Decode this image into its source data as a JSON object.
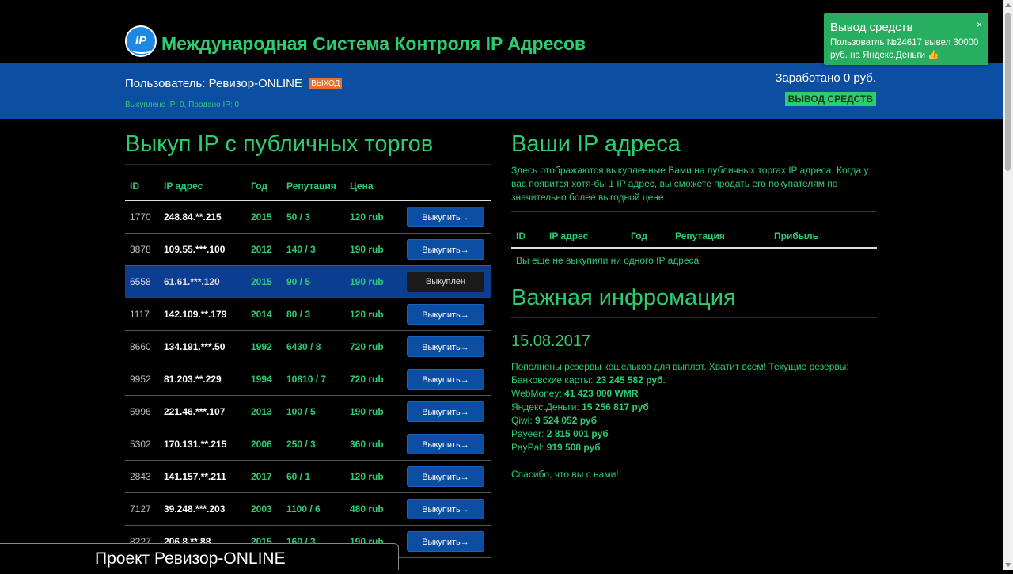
{
  "header": {
    "logo_text": "IP",
    "title": "Международная Система Контроля IP Адресов"
  },
  "userbar": {
    "user_label": "Пользователь: Ревизор-ONLINE",
    "logout": "ВЫХОД",
    "ip_stats": "Выкуплено IP: 0, Продано IP: 0",
    "earned": "Заработано 0 руб.",
    "withdraw": "ВЫВОД СРЕДСТВ"
  },
  "market": {
    "title": "Выкуп IP с публичных торгов",
    "columns": [
      "ID",
      "IP адрес",
      "Год",
      "Репутация",
      "Цена"
    ],
    "buy_label": "Выкупить",
    "bought_label": "Выкуплен",
    "rows": [
      {
        "id": "1770",
        "ip": "248.84.**.215",
        "year": "2015",
        "rep": "50 / 3",
        "price": "120 rub",
        "bought": false
      },
      {
        "id": "3878",
        "ip": "109.55.***.100",
        "year": "2012",
        "rep": "140 / 3",
        "price": "190 rub",
        "bought": false
      },
      {
        "id": "6558",
        "ip": "61.61.***.120",
        "year": "2015",
        "rep": "90 / 5",
        "price": "190 rub",
        "bought": true
      },
      {
        "id": "1117",
        "ip": "142.109.**.179",
        "year": "2014",
        "rep": "80 / 3",
        "price": "120 rub",
        "bought": false
      },
      {
        "id": "8660",
        "ip": "134.191.***.50",
        "year": "1992",
        "rep": "6430 / 8",
        "price": "720 rub",
        "bought": false
      },
      {
        "id": "9952",
        "ip": "81.203.**.229",
        "year": "1994",
        "rep": "10810 / 7",
        "price": "720 rub",
        "bought": false
      },
      {
        "id": "5996",
        "ip": "221.46.***.107",
        "year": "2013",
        "rep": "100 / 5",
        "price": "190 rub",
        "bought": false
      },
      {
        "id": "5302",
        "ip": "170.131.**.215",
        "year": "2006",
        "rep": "250 / 3",
        "price": "360 rub",
        "bought": false
      },
      {
        "id": "2843",
        "ip": "141.157.**.211",
        "year": "2017",
        "rep": "60 / 1",
        "price": "120 rub",
        "bought": false
      },
      {
        "id": "7127",
        "ip": "39.248.***.203",
        "year": "2003",
        "rep": "1100 / 6",
        "price": "480 rub",
        "bought": false
      },
      {
        "id": "8227",
        "ip": "206.8.**.88",
        "year": "2015",
        "rep": "160 / 3",
        "price": "190 rub",
        "bought": false
      }
    ]
  },
  "mine": {
    "title": "Ваши IP адреса",
    "description": "Здесь отображаются выкупленные Вами на публичных торгах IP адреса. Когда у вас появится хотя-бы 1 IP адрес, вы сможете продать его покупателям по значительно более выгодной цене",
    "columns": [
      "ID",
      "IP адрес",
      "Год",
      "Репутация",
      "Прибыль"
    ],
    "empty": "Вы еще не выкупили ни одного IP адреса"
  },
  "info": {
    "title": "Важная инфромация",
    "date": "15.08.2017",
    "intro": "Пополнены резервы кошельков для выплат. Хватит всем! Текущие резервы:",
    "reserves": [
      {
        "label": "Банковские карты:",
        "value": "23 245 582 руб."
      },
      {
        "label": "WebMoney:",
        "value": "41 423 000 WMR"
      },
      {
        "label": "Яндекс.Деньги:",
        "value": "15 256 817 руб"
      },
      {
        "label": "Qiwi:",
        "value": "9 524 052 руб"
      },
      {
        "label": "Payeer:",
        "value": "2 815 001 руб"
      },
      {
        "label": "PayPal:",
        "value": "919 508 руб"
      }
    ],
    "thanks": "Спасибо, что вы с нами!"
  },
  "toast": {
    "title": "Вывод средств",
    "text": "Пользоватль №24617 вывел 30000 руб. на Яндекс.Деньги 👍",
    "close": "×"
  },
  "caption": "Проект Ревизор-ONLINE"
}
